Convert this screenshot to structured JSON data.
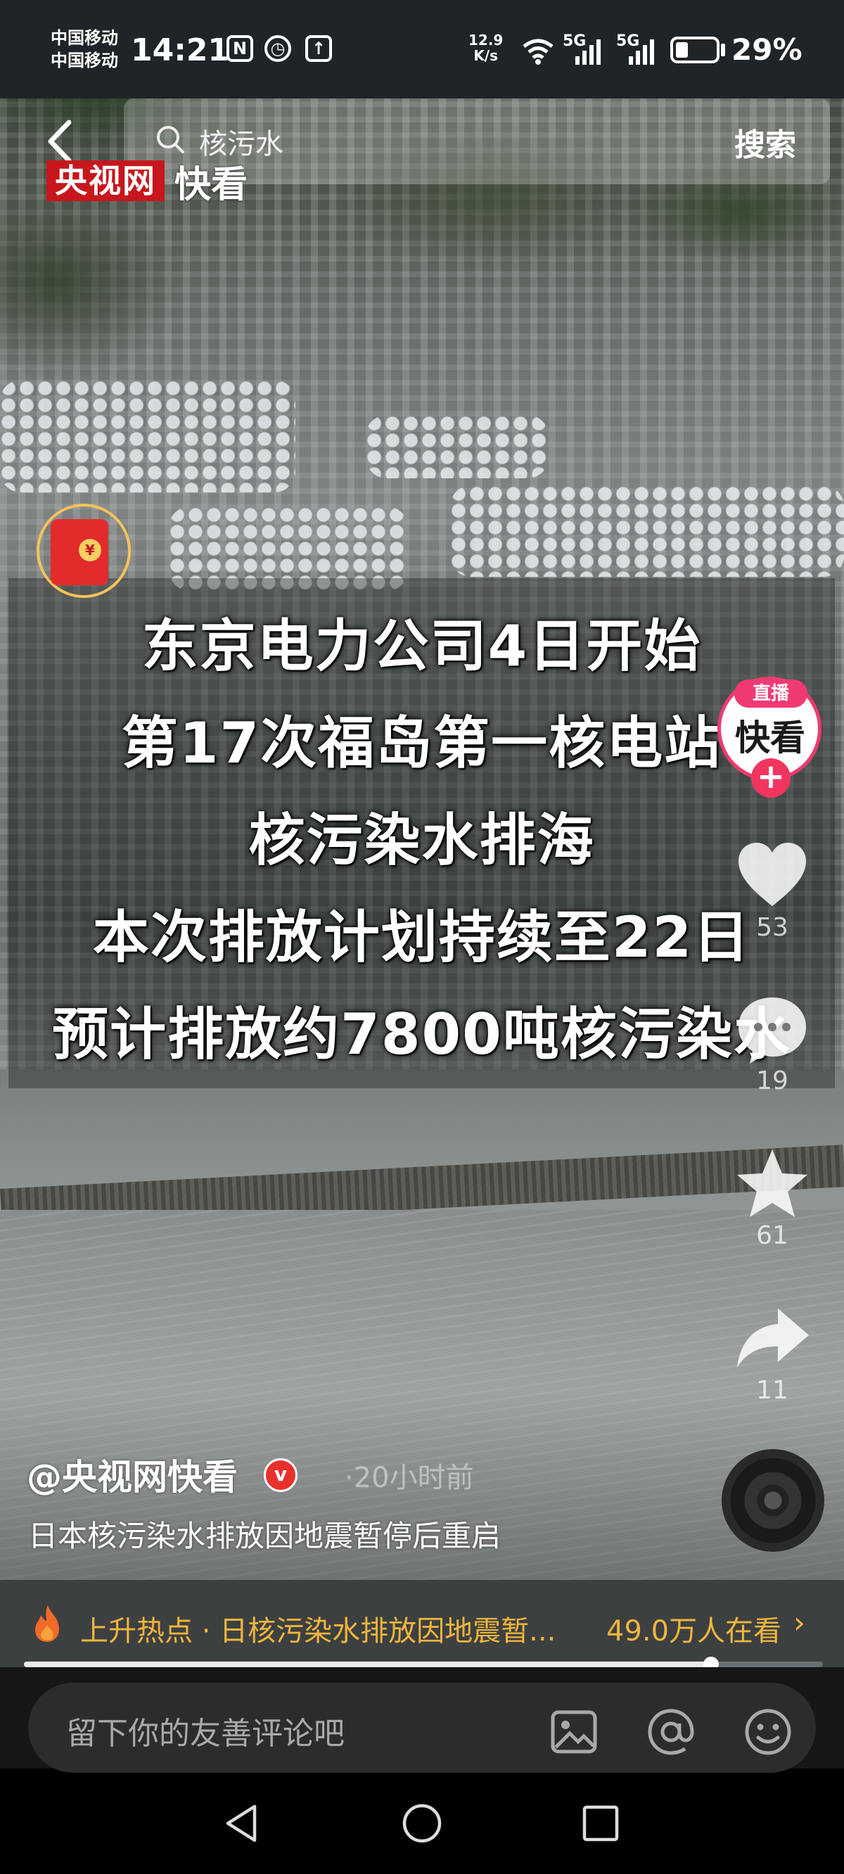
{
  "status_bar": {
    "carrier_1": "中国移动",
    "carrier_2": "中国移动",
    "time": "14:21",
    "net_speed_value": "12.9",
    "net_speed_unit": "K/s",
    "signal_1_label": "5G",
    "signal_2_label": "5G",
    "battery_percent": "29%",
    "battery_level": 0.29
  },
  "search": {
    "query": "核污水",
    "button_label": "搜索"
  },
  "logo": {
    "red_text": "央视网",
    "white_text": "快看"
  },
  "headline": {
    "lines": [
      "东京电力公司4日开始",
      "第17次福岛第一核电站",
      "核污染水排海",
      "本次排放计划持续至22日",
      "预计排放约7800吨核污染水"
    ]
  },
  "live": {
    "badge": "直播",
    "avatar_text": "快看"
  },
  "actions": {
    "like_count": "53",
    "comment_count": "19",
    "favorite_count": "61",
    "share_count": "11"
  },
  "author": {
    "handle": "@央视网快看",
    "verified_badge": "v",
    "time": "·20小时前",
    "caption": "日本核污染水排放因地震暂停后重启"
  },
  "hot_topic": {
    "text": "上升热点 · 日核污染水排放因地震暂...",
    "watching": "49.0万人在看",
    "chevron": "›"
  },
  "progress": {
    "fraction": 0.86
  },
  "comment": {
    "placeholder": "留下你的友善评论吧"
  },
  "colors": {
    "hot": "#f0b63c",
    "live_pink": "#f03a74",
    "brand_red": "#c8161d"
  },
  "icons": [
    "back-arrow-icon",
    "search-icon",
    "red-packet-icon",
    "heart-icon",
    "comment-icon",
    "star-icon",
    "share-icon",
    "fire-icon",
    "image-icon",
    "at-icon",
    "emoji-icon",
    "nav-back-icon",
    "nav-home-icon",
    "nav-recents-icon"
  ]
}
